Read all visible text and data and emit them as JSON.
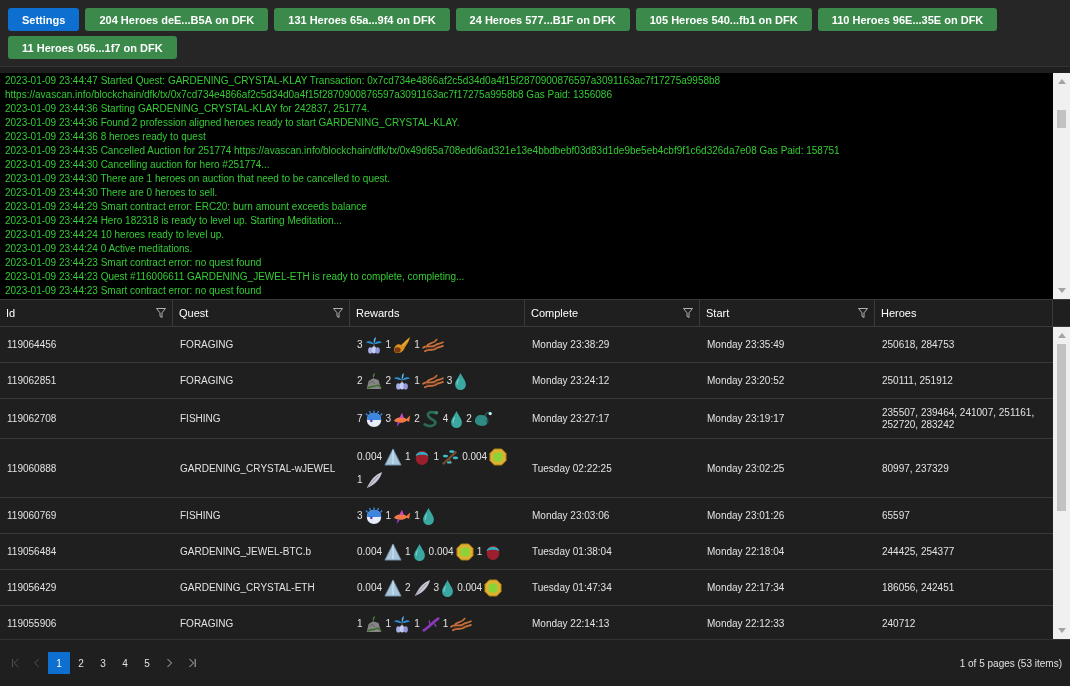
{
  "toolbar": {
    "buttons": [
      {
        "label": "Settings",
        "kind": "primary"
      },
      {
        "label": "204 Heroes deE...B5A on DFK",
        "kind": "wallet"
      },
      {
        "label": "131 Heroes 65a...9f4 on DFK",
        "kind": "wallet"
      },
      {
        "label": "24 Heroes 577...B1F on DFK",
        "kind": "wallet"
      },
      {
        "label": "105 Heroes 540...fb1 on DFK",
        "kind": "wallet"
      },
      {
        "label": "110 Heroes 96E...35E on DFK",
        "kind": "wallet"
      },
      {
        "label": "11 Heroes 056...1f7 on DFK",
        "kind": "wallet"
      }
    ]
  },
  "log": {
    "lines": [
      "2023-01-09 23:44:47 Started Quest: GARDENING_CRYSTAL-KLAY Transaction: 0x7cd734e4866af2c5d34d0a4f15f2870900876597a3091163ac7f17275a9958b8",
      "https://avascan.info/blockchain/dfk/tx/0x7cd734e4866af2c5d34d0a4f15f2870900876597a3091163ac7f17275a9958b8 Gas Paid: 1356086",
      "2023-01-09 23:44:36 Starting GARDENING_CRYSTAL-KLAY for 242837, 251774.",
      "2023-01-09 23:44:36 Found 2 profession aligned heroes ready to start GARDENING_CRYSTAL-KLAY.",
      "2023-01-09 23:44:36 8 heroes ready to quest",
      "2023-01-09 23:44:35 Cancelled Auction for 251774 https://avascan.info/blockchain/dfk/tx/0x49d65a708edd6ad321e13e4bbdbebf03d83d1de9be5eb4cbf9f1c6d326da7e08 Gas Paid: 158751",
      "2023-01-09 23:44:30 Cancelling auction for hero #251774...",
      "2023-01-09 23:44:30 There are 1 heroes on auction that need to be cancelled to quest.",
      "2023-01-09 23:44:30 There are 0 heroes to sell.",
      "2023-01-09 23:44:29 Smart contract error: ERC20: burn amount exceeds balance",
      "2023-01-09 23:44:24 Hero 182318 is ready to level up. Starting Meditation...",
      "2023-01-09 23:44:24 10 heroes ready to level up.",
      "2023-01-09 23:44:24 0 Active meditations.",
      "2023-01-09 23:44:23 Smart contract error: no quest found",
      "2023-01-09 23:44:23 Quest #116006611 GARDENING_JEWEL-ETH is ready to complete, completing...",
      "2023-01-09 23:44:23 Smart contract error: no quest found"
    ]
  },
  "table": {
    "columns": [
      {
        "label": "Id",
        "filter": true
      },
      {
        "label": "Quest",
        "filter": true
      },
      {
        "label": "Rewards",
        "filter": false
      },
      {
        "label": "Complete",
        "filter": true
      },
      {
        "label": "Start",
        "filter": true
      },
      {
        "label": "Heroes",
        "filter": false
      }
    ],
    "rows": [
      {
        "id": "119064456",
        "quest": "FORAGING",
        "rewards": [
          {
            "amount": "3",
            "kind": "plant"
          },
          {
            "amount": "1",
            "kind": "horn"
          },
          {
            "amount": "1",
            "kind": "root"
          }
        ],
        "complete": "Monday 23:38:29",
        "start": "Monday 23:35:49",
        "heroes": "250618, 284753"
      },
      {
        "id": "119062851",
        "quest": "FORAGING",
        "rewards": [
          {
            "amount": "2",
            "kind": "rock"
          },
          {
            "amount": "2",
            "kind": "plant"
          },
          {
            "amount": "1",
            "kind": "root"
          },
          {
            "amount": "3",
            "kind": "drop"
          }
        ],
        "complete": "Monday 23:24:12",
        "start": "Monday 23:20:52",
        "heroes": "250111, 251912"
      },
      {
        "id": "119062708",
        "quest": "FISHING",
        "rewards": [
          {
            "amount": "7",
            "kind": "puffer"
          },
          {
            "amount": "3",
            "kind": "fish"
          },
          {
            "amount": "2",
            "kind": "eel"
          },
          {
            "amount": "4",
            "kind": "drop"
          },
          {
            "amount": "2",
            "kind": "angler"
          }
        ],
        "complete": "Monday 23:27:17",
        "start": "Monday 23:19:17",
        "heroes": "235507, 239464, 241007, 251161, 252720, 283242"
      },
      {
        "id": "119060888",
        "quest": "GARDENING_CRYSTAL-wJEWEL",
        "rewards": [
          {
            "amount": "0.004",
            "kind": "pyramid"
          },
          {
            "amount": "1",
            "kind": "egg"
          },
          {
            "amount": "1",
            "kind": "branch"
          },
          {
            "amount": "0.004",
            "kind": "gem"
          },
          {
            "amount": "1",
            "kind": "feather"
          }
        ],
        "complete": "Tuesday 02:22:25",
        "start": "Monday 23:02:25",
        "heroes": "80997, 237329"
      },
      {
        "id": "119060769",
        "quest": "FISHING",
        "rewards": [
          {
            "amount": "3",
            "kind": "puffer"
          },
          {
            "amount": "1",
            "kind": "fish"
          },
          {
            "amount": "1",
            "kind": "drop"
          }
        ],
        "complete": "Monday 23:03:06",
        "start": "Monday 23:01:26",
        "heroes": "65597"
      },
      {
        "id": "119056484",
        "quest": "GARDENING_JEWEL-BTC.b",
        "rewards": [
          {
            "amount": "0.004",
            "kind": "pyramid"
          },
          {
            "amount": "1",
            "kind": "drop"
          },
          {
            "amount": "0.004",
            "kind": "gem"
          },
          {
            "amount": "1",
            "kind": "egg"
          }
        ],
        "complete": "Tuesday 01:38:04",
        "start": "Monday 22:18:04",
        "heroes": "244425, 254377"
      },
      {
        "id": "119056429",
        "quest": "GARDENING_CRYSTAL-ETH",
        "rewards": [
          {
            "amount": "0.004",
            "kind": "pyramid"
          },
          {
            "amount": "2",
            "kind": "feather"
          },
          {
            "amount": "3",
            "kind": "drop"
          },
          {
            "amount": "0.004",
            "kind": "gem"
          }
        ],
        "complete": "Tuesday 01:47:34",
        "start": "Monday 22:17:34",
        "heroes": "186056, 242451"
      },
      {
        "id": "119055906",
        "quest": "FORAGING",
        "rewards": [
          {
            "amount": "1",
            "kind": "rock"
          },
          {
            "amount": "1",
            "kind": "plant"
          },
          {
            "amount": "1",
            "kind": "twig"
          },
          {
            "amount": "1",
            "kind": "root"
          }
        ],
        "complete": "Monday 22:14:13",
        "start": "Monday 22:12:33",
        "heroes": "240712"
      }
    ]
  },
  "pager": {
    "back": [
      {
        "kind": "first",
        "disabled": true
      },
      {
        "kind": "prev",
        "disabled": true
      }
    ],
    "pages": [
      {
        "label": "1",
        "selected": true
      },
      {
        "label": "2",
        "selected": false
      },
      {
        "label": "3",
        "selected": false
      },
      {
        "label": "4",
        "selected": false
      },
      {
        "label": "5",
        "selected": false
      }
    ],
    "forward": [
      {
        "kind": "next",
        "disabled": false
      },
      {
        "kind": "last",
        "disabled": false
      }
    ],
    "summary": "1 of 5 pages (53 items)"
  }
}
